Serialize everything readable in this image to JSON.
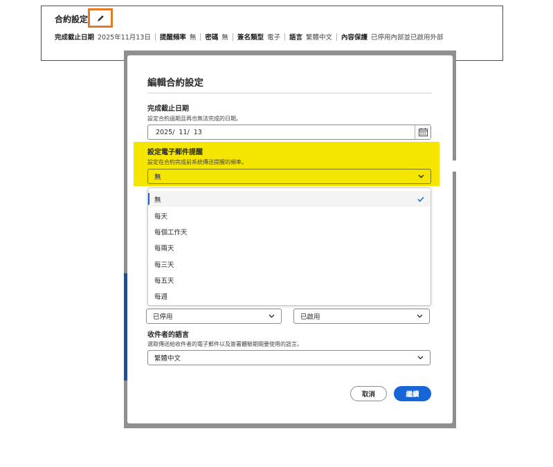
{
  "background_card": {
    "title": "合約設定",
    "summary": [
      {
        "key": "完成截止日期",
        "value": "2025年11月13日"
      },
      {
        "key": "提醒頻率",
        "value": "無"
      },
      {
        "key": "密碼",
        "value": "無"
      },
      {
        "key": "簽名類型",
        "value": "電子"
      },
      {
        "key": "語言",
        "value": "繁體中文"
      },
      {
        "key": "內容保護",
        "value": "已停用內部並已啟用外部"
      }
    ]
  },
  "dialog": {
    "title": "編輯合約設定",
    "deadline": {
      "label": "完成截止日期",
      "hint": "設定合約過期且再也無法完成的日期。",
      "value": "2025/  11/  13"
    },
    "reminder": {
      "label": "設定電子郵件提醒",
      "hint": "設定在合約完成前系統傳送提醒的頻率。",
      "value": "無",
      "options": [
        "無",
        "每天",
        "每個工作天",
        "每兩天",
        "每三天",
        "每五天",
        "每週"
      ],
      "selected_index": 0
    },
    "protection": {
      "internal_value": "已停用",
      "external_value": "已啟用"
    },
    "language": {
      "label": "收件者的語言",
      "hint": "選取傳送給收件者的電子郵件以及簽署體驗期間要使用的語言。",
      "value": "繁體中文"
    },
    "cancel_label": "取消",
    "continue_label": "繼續"
  },
  "colors": {
    "highlight": "#f5e600",
    "edit_outline": "#e57a25",
    "primary": "#1766d6"
  }
}
